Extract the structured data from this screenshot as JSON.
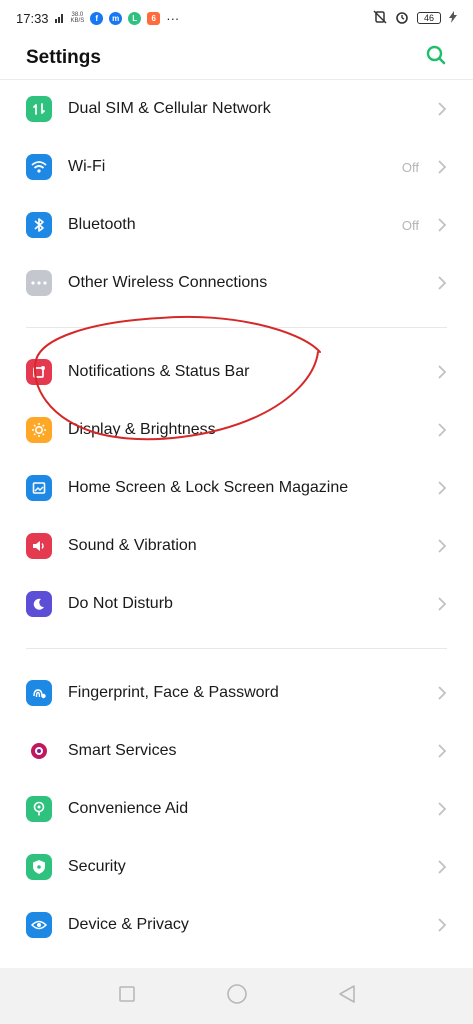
{
  "status_bar": {
    "time": "17:33",
    "network_speed_top": "38.0",
    "network_speed_bottom": "KB/S",
    "more": "···",
    "battery": "46"
  },
  "header": {
    "title": "Settings",
    "search_icon": "search-icon"
  },
  "groups": [
    {
      "items": [
        {
          "label": "Dual SIM & Cellular Network",
          "value": "",
          "icon": "sim-icon",
          "color": "#2ec27e"
        },
        {
          "label": "Wi-Fi",
          "value": "Off",
          "icon": "wifi-icon",
          "color": "#1e88e5"
        },
        {
          "label": "Bluetooth",
          "value": "Off",
          "icon": "bluetooth-icon",
          "color": "#1e88e5"
        },
        {
          "label": "Other Wireless Connections",
          "value": "",
          "icon": "more-dots-icon",
          "color": "#c4c8ce"
        }
      ]
    },
    {
      "items": [
        {
          "label": "Notifications & Status Bar",
          "value": "",
          "icon": "notification-icon",
          "color": "#e53950"
        },
        {
          "label": "Display & Brightness",
          "value": "",
          "icon": "sun-icon",
          "color": "#ffa726"
        },
        {
          "label": "Home Screen & Lock Screen Magazine",
          "value": "",
          "icon": "image-icon",
          "color": "#1e88e5"
        },
        {
          "label": "Sound & Vibration",
          "value": "",
          "icon": "speaker-icon",
          "color": "#e53950"
        },
        {
          "label": "Do Not Disturb",
          "value": "",
          "icon": "moon-icon",
          "color": "#5c4fd6"
        }
      ]
    },
    {
      "items": [
        {
          "label": "Fingerprint, Face & Password",
          "value": "",
          "icon": "fingerprint-icon",
          "color": "#1e88e5"
        },
        {
          "label": "Smart Services",
          "value": "",
          "icon": "smart-services-icon",
          "color": "#c2185b"
        },
        {
          "label": "Convenience Aid",
          "value": "",
          "icon": "convenience-icon",
          "color": "#2ec27e"
        },
        {
          "label": "Security",
          "value": "",
          "icon": "shield-icon",
          "color": "#2ec27e"
        },
        {
          "label": "Device & Privacy",
          "value": "",
          "icon": "privacy-eye-icon",
          "color": "#1e88e5"
        }
      ]
    }
  ],
  "nav_bar": {
    "buttons": [
      "recent-apps-icon",
      "home-icon",
      "back-icon"
    ]
  },
  "colors": {
    "accent": "#1fbf6b",
    "annotation": "#d62828"
  }
}
